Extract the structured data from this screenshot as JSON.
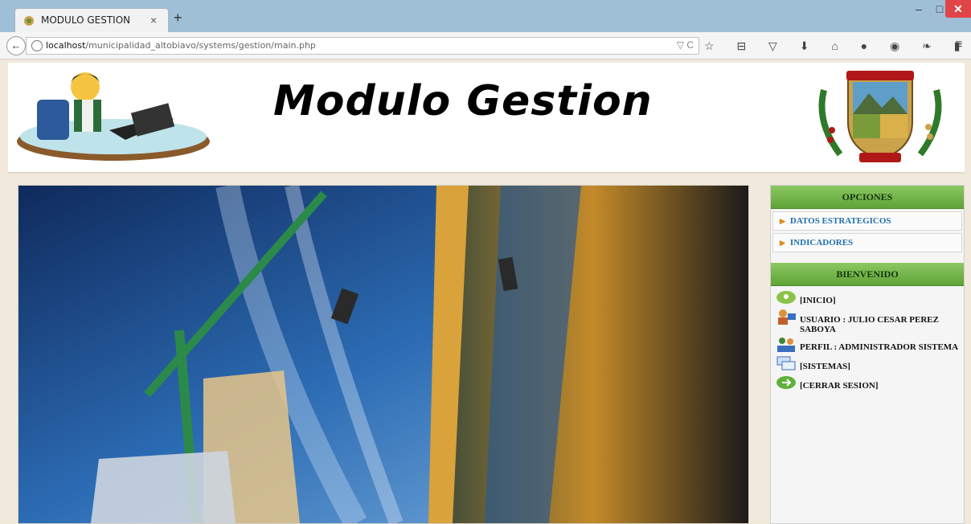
{
  "browser": {
    "tab_title": "MODULO GESTION",
    "tab_close": "×",
    "new_tab": "+",
    "url_host": "localhost",
    "url_path": "/municipalidad_altobiavo/systems/gestion/main.php",
    "url_actions": "▽ C",
    "toolbar_icons": "☆ ⊟ ▽ ⬇ ⌂ ● ◉ ❧ ▮ ▾",
    "menu_icon": "≡",
    "win_min": "–",
    "win_max": "□",
    "win_close": "✕"
  },
  "header": {
    "title": "Modulo Gestion"
  },
  "sidebar": {
    "options_title": "OPCIONES",
    "options": [
      {
        "label": "DATOS ESTRATEGICOS"
      },
      {
        "label": "INDICADORES"
      }
    ],
    "welcome_title": "BIENVENIDO",
    "welcome_items": [
      {
        "label": "[INICIO]",
        "icon": "home-icon"
      },
      {
        "label": "USUARIO : JULIO CESAR PEREZ SABOYA",
        "icon": "user-icon"
      },
      {
        "label": "PERFIL : ADMINISTRADOR SISTEMA",
        "icon": "profile-icon"
      },
      {
        "label": "[SISTEMAS]",
        "icon": "windows-icon"
      },
      {
        "label": "[CERRAR SESION]",
        "icon": "logout-icon"
      }
    ]
  },
  "colors": {
    "accent_green": "#6cb043",
    "link_blue": "#1f6fae",
    "close_red": "#e0454a"
  }
}
